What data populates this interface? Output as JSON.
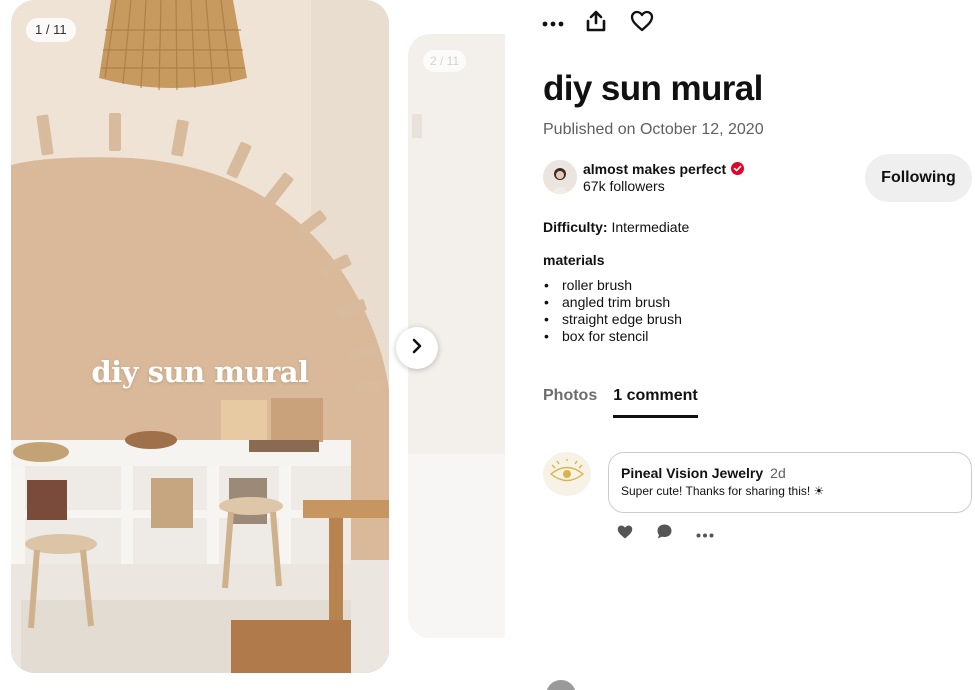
{
  "gallery": {
    "counter": "1 / 11",
    "overlay_title": "diy sun mural",
    "next_counter": "2 / 11",
    "next_button_icon": "chevron-right-icon"
  },
  "toolbar": {
    "more_icon": "ellipsis-icon",
    "share_icon": "share-icon",
    "like_icon": "heart-icon"
  },
  "pin": {
    "title": "diy sun mural",
    "published": "Published on October 12, 2020"
  },
  "creator": {
    "name": "almost makes perfect",
    "followers": "67k followers",
    "verified_color": "#e60023",
    "follow_label": "Following"
  },
  "details": {
    "difficulty_label": "Difficulty:",
    "difficulty_value": "Intermediate",
    "materials_title": "materials",
    "materials": [
      "roller brush",
      "angled trim brush",
      "straight edge brush",
      "box for stencil"
    ]
  },
  "tabs": [
    {
      "label": "Photos",
      "active": false
    },
    {
      "label": "1 comment",
      "active": true
    }
  ],
  "comment": {
    "author": "Pineal Vision Jewelry",
    "age": "2d",
    "text": "Super cute! Thanks for sharing this! ☀"
  }
}
